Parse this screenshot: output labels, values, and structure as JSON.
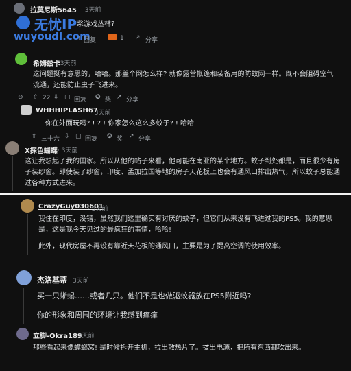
{
  "watermark": {
    "title": "无忧IP",
    "url": "wuyoudl.com"
  },
  "c1": {
    "user": "拉莫尼斯5645",
    "time": "· 3天前",
    "text": "浆游戏丛林?",
    "reply": "回复",
    "share": "分享",
    "award": "1"
  },
  "c2": {
    "user": "希姆兹卡",
    "time": "· 3天前",
    "text": "这问题挺有意思的，哈哈。那盖个网怎么样? 就像露营帐篷和装备用的防蚊网一样。既不会阻碍空气流通，还能防止虫子飞进来。",
    "votes": "22",
    "reply": "回复",
    "award": "奖",
    "share": "分享"
  },
  "c3": {
    "user": "WHHHIPLASH67",
    "time": "· 3天前",
    "text": "你在外面玩吗? ! ? ! 你家怎么这么多蚊子? ! 哈哈",
    "votes": "三十六",
    "reply": "回复",
    "award": "奖",
    "share": "分享"
  },
  "c4": {
    "user": "X探色蝴蝶",
    "time": "· 3天前",
    "text": "这让我想起了我的国家。所以从他的帖子来看，他可能在南亚的某个地方。蚊子到处都是，而且很少有房子装纱窗。即使装了纱窗，印度、孟加拉国等地的房子天花板上也会有通风口排出热气，所以蚊子总能通过各种方式进来。"
  },
  "c5": {
    "user": "CrazyGuy030601",
    "time": "· 3天前",
    "text1": "我住在印度，没错，虽然我们这里确实有讨厌的蚊子，但它们从来没有飞进过我的PS5。我的意思是，这是我今天见过的最疯狂的事情，哈哈!",
    "text2": "此外，现代房屋不再设有靠近天花板的通风口，主要是为了提高空调的使用效率。"
  },
  "c6": {
    "user": "杰洛基蒂",
    "time": "3天前",
    "text1": "买一只蜥蜴……或者几只。他们不是也做驱蚊器放在PS5附近吗?",
    "text2": "你的形象和周围的环境让我感到痒痒"
  },
  "c7": {
    "user": "立脚-Okra189",
    "time": "· 3天前",
    "text": "那些看起来像蟑螂窝! 是时候拆开主机，拉出散热片了。拔出电源，把所有东西都吹出来。"
  }
}
